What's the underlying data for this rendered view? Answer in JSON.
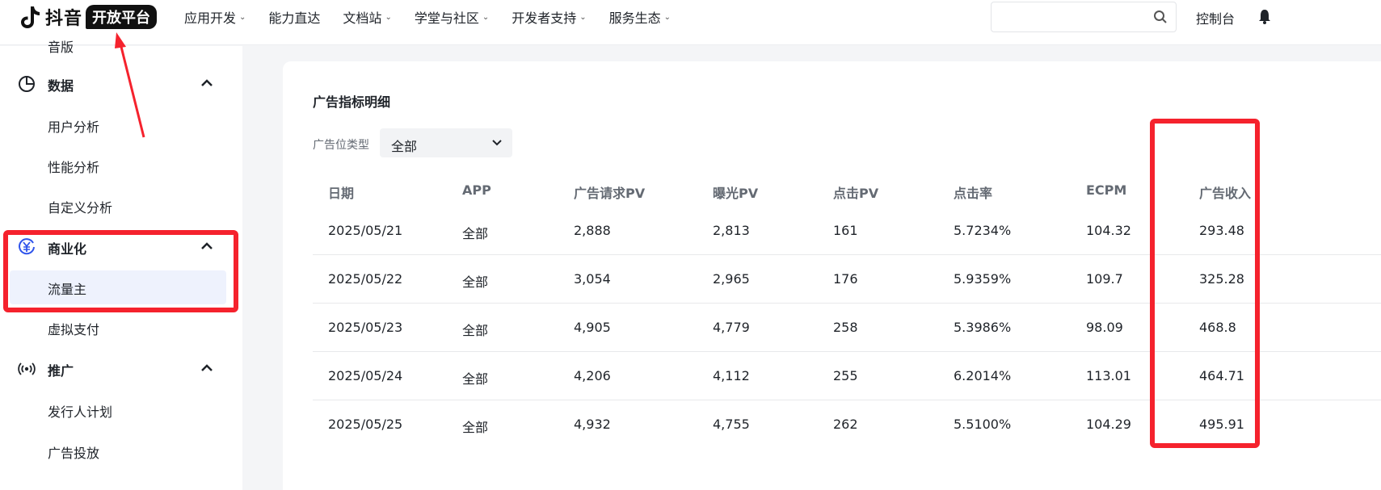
{
  "header": {
    "logo_text": "抖音",
    "logo_badge": "开放平台",
    "nav": [
      {
        "label": "应用开发",
        "has_dropdown": true
      },
      {
        "label": "能力直达",
        "has_dropdown": false
      },
      {
        "label": "文档站",
        "has_dropdown": true
      },
      {
        "label": "学堂与社区",
        "has_dropdown": true
      },
      {
        "label": "开发者支持",
        "has_dropdown": true
      },
      {
        "label": "服务生态",
        "has_dropdown": true
      }
    ],
    "search_placeholder": "",
    "console_label": "控制台",
    "dropdown_glyph": "⌄"
  },
  "sidebar": {
    "partial_top_label": "音版",
    "groups": [
      {
        "label": "数据",
        "icon": "pie-chart-icon",
        "items": [
          "用户分析",
          "性能分析",
          "自定义分析"
        ]
      },
      {
        "label": "商业化",
        "icon": "yen-coin-icon",
        "items": [
          "流量主",
          "虚拟支付"
        ],
        "active_item": "流量主"
      },
      {
        "label": "推广",
        "icon": "broadcast-icon",
        "items": [
          "发行人计划",
          "广告投放"
        ]
      }
    ]
  },
  "main": {
    "title": "广告指标明细",
    "filter": {
      "label": "广告位类型",
      "value": "全部"
    },
    "columns": [
      "日期",
      "APP",
      "广告请求PV",
      "曝光PV",
      "点击PV",
      "点击率",
      "ECPM",
      "广告收入"
    ],
    "rows": [
      [
        "2025/05/21",
        "全部",
        "2,888",
        "2,813",
        "161",
        "5.7234%",
        "104.32",
        "293.48"
      ],
      [
        "2025/05/22",
        "全部",
        "3,054",
        "2,965",
        "176",
        "5.9359%",
        "109.7",
        "325.28"
      ],
      [
        "2025/05/23",
        "全部",
        "4,905",
        "4,779",
        "258",
        "5.3986%",
        "98.09",
        "468.8"
      ],
      [
        "2025/05/24",
        "全部",
        "4,206",
        "4,112",
        "255",
        "6.2014%",
        "113.01",
        "464.71"
      ],
      [
        "2025/05/25",
        "全部",
        "4,932",
        "4,755",
        "262",
        "5.5100%",
        "104.29",
        "495.91"
      ]
    ]
  },
  "colors": {
    "annotation_red": "#f5222d",
    "active_bg": "#eef2fd",
    "accent_blue": "#2f54eb"
  }
}
